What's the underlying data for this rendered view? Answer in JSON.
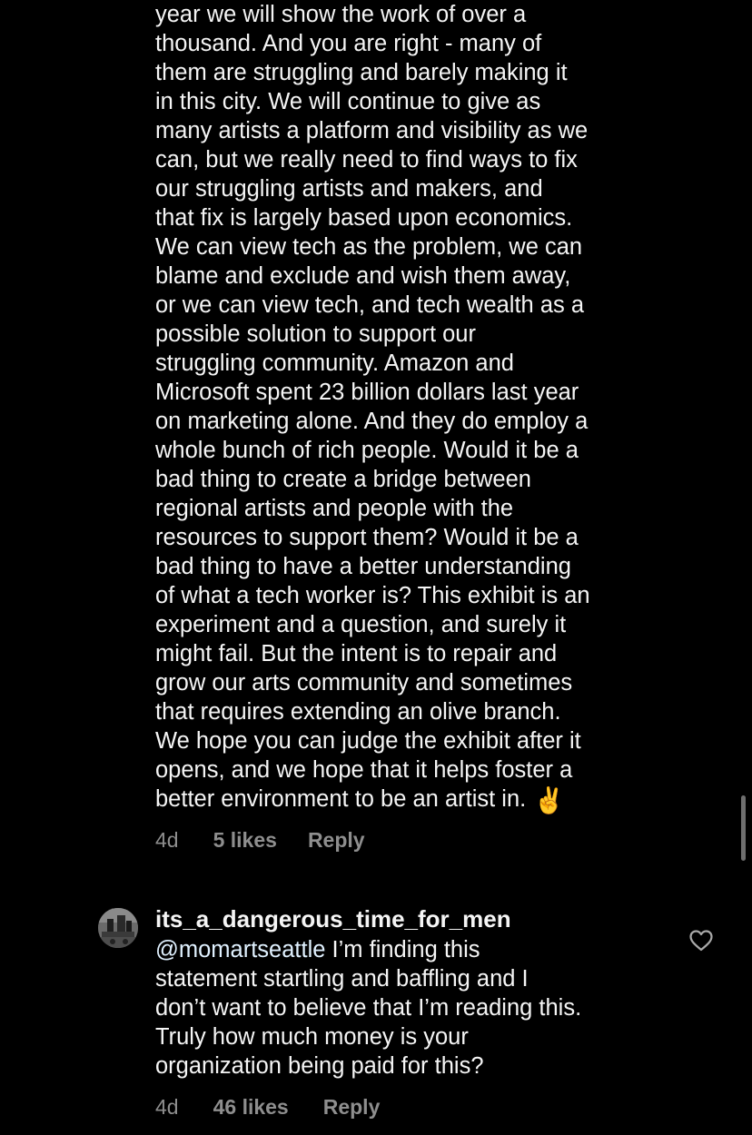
{
  "comment_1": {
    "lines": [
      "year we will show the work of over a",
      "thousand. And you are right - many of",
      "them are struggling and barely making it",
      "in this city. We will continue to give as",
      "many artists a platform and visibility as we",
      "can, but we really need to find ways to fix",
      "our struggling artists and makers, and",
      "that fix is largely based upon economics.",
      "We can view tech as the problem, we can",
      "blame and exclude and wish them away,",
      "or we can view tech, and tech wealth as a",
      "possible solution to support our",
      "struggling community. Amazon and",
      "Microsoft spent 23 billion dollars last year",
      "on marketing alone. And they do employ a",
      "whole bunch of rich people. Would it be a",
      "bad thing to create a bridge between",
      "regional artists and people with the",
      "resources to support them? Would it be a",
      "bad thing to have a better understanding",
      "of what a tech worker is? This exhibit is an",
      "experiment and a question, and surely it",
      "might fail. But the intent is to repair and",
      "grow our arts community and sometimes",
      "that requires extending an olive branch.",
      "We hope you can judge the exhibit after it",
      "opens, and we hope that it helps foster a",
      "better environment to be an artist in."
    ],
    "emoji": "✌️",
    "time": "4d",
    "likes": "5 likes",
    "reply": "Reply"
  },
  "comment_2": {
    "username": "its_a_dangerous_time_for_men",
    "mention": "@momartseattle",
    "first_line_rest": " I’m finding this",
    "lines": [
      "statement startling and baffling and I",
      "don’t want to believe that I’m reading this.",
      "Truly how much money is your",
      "organization being paid for this?"
    ],
    "time": "4d",
    "likes": "46 likes",
    "reply": "Reply",
    "like_icon": "heart-outline-icon"
  },
  "colors": {
    "background": "#000000",
    "text": "#f5f5f5",
    "meta": "#8e8e8e",
    "mention": "#e0f1ff"
  }
}
